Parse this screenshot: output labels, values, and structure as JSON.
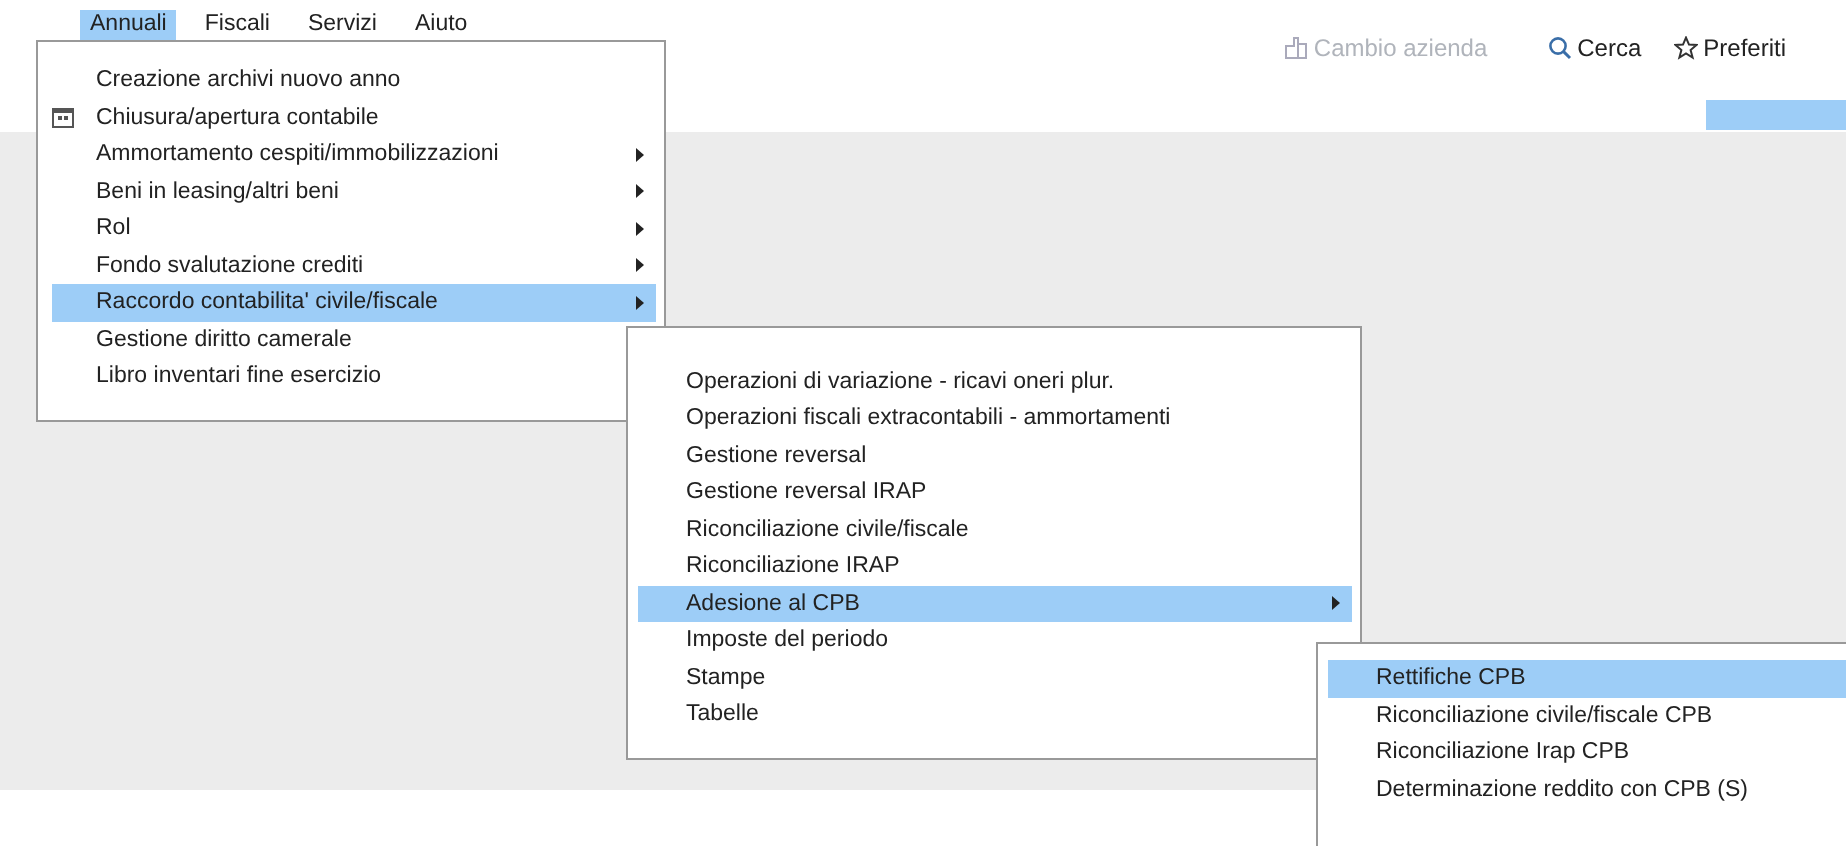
{
  "menubar": [
    {
      "label": "Annuali",
      "selected": true
    },
    {
      "label": "Fiscali",
      "selected": false
    },
    {
      "label": "Servizi",
      "selected": false
    },
    {
      "label": "Aiuto",
      "selected": false
    }
  ],
  "toolbar": [
    {
      "label": "Cambio azienda",
      "kind": "company",
      "disabled": true
    },
    {
      "label": "Cerca",
      "kind": "search",
      "disabled": false
    },
    {
      "label": "Preferiti",
      "kind": "star",
      "disabled": false
    }
  ],
  "menu": {
    "items": [
      {
        "label": "Creazione archivi nuovo anno",
        "submenu": false,
        "selected": false
      },
      {
        "label": "Chiusura/apertura contabile",
        "kind": "calendar",
        "submenu": false,
        "selected": false
      },
      {
        "label": "Ammortamento cespiti/immobilizzazioni",
        "submenu": true,
        "selected": false
      },
      {
        "label": "Beni in leasing/altri beni",
        "submenu": true,
        "selected": false
      },
      {
        "label": "Rol",
        "submenu": true,
        "selected": false
      },
      {
        "label": "Fondo svalutazione crediti",
        "submenu": true,
        "selected": false
      },
      {
        "label": "Raccordo contabilita' civile/fiscale",
        "submenu": true,
        "selected": true,
        "children": [
          {
            "label": "Operazioni di variazione - ricavi oneri plur.",
            "submenu": false,
            "selected": false
          },
          {
            "label": "Operazioni fiscali extracontabili - ammortamenti",
            "submenu": false,
            "selected": false
          },
          {
            "label": "Gestione reversal",
            "submenu": false,
            "selected": false
          },
          {
            "label": "Gestione reversal IRAP",
            "submenu": false,
            "selected": false
          },
          {
            "label": "Riconciliazione civile/fiscale",
            "submenu": false,
            "selected": false
          },
          {
            "label": "Riconciliazione IRAP",
            "submenu": false,
            "selected": false
          },
          {
            "label": "Adesione al CPB",
            "submenu": true,
            "selected": true,
            "children": [
              {
                "label": "Rettifiche CPB",
                "submenu": false,
                "selected": true
              },
              {
                "label": "Riconciliazione civile/fiscale CPB",
                "submenu": false,
                "selected": false
              },
              {
                "label": "Riconciliazione Irap CPB",
                "submenu": false,
                "selected": false
              },
              {
                "label": "Determinazione reddito con CPB (S)",
                "submenu": false,
                "selected": false
              }
            ]
          },
          {
            "label": "Imposte del periodo",
            "submenu": false,
            "selected": false
          },
          {
            "label": "Stampe",
            "submenu": false,
            "selected": false
          },
          {
            "label": "Tabelle",
            "submenu": false,
            "selected": false
          }
        ]
      },
      {
        "label": "Gestione diritto camerale",
        "submenu": false,
        "selected": false
      },
      {
        "label": "Libro inventari fine esercizio",
        "submenu": false,
        "selected": false
      }
    ]
  }
}
